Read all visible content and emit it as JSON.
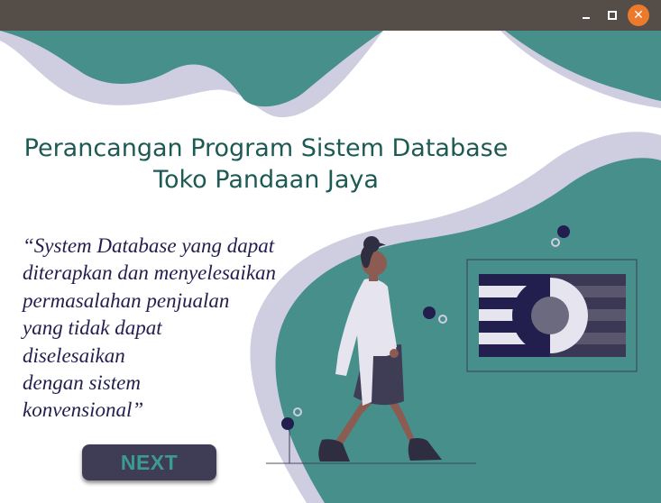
{
  "window": {
    "controls": {
      "minimize_icon": "minimize-icon",
      "maximize_icon": "maximize-icon",
      "close_icon": "close-icon",
      "close_glyph": "✕"
    },
    "colors": {
      "titlebar": "#544d48",
      "close_button": "#ec7a2c"
    }
  },
  "hero": {
    "title_line1": "Perancangan Program Sistem Database",
    "title_line2": "Toko Pandaan Jaya",
    "quote_lines": [
      "“System Database yang dapat",
      "diterapkan dan menyelesaikan",
      "permasalahan penjualan",
      "yang tidak dapat",
      "diselesaikan",
      "dengan sistem",
      "konvensional”"
    ],
    "next_label": "NEXT",
    "illustration_icon": "woman-walking-illustration",
    "colors": {
      "teal": "#468f8a",
      "accent": "#3c9a94",
      "lavender": "#cfcde0",
      "dark": "#3f3d56",
      "navy": "#221f4f",
      "title_text": "#1e5a54"
    }
  }
}
